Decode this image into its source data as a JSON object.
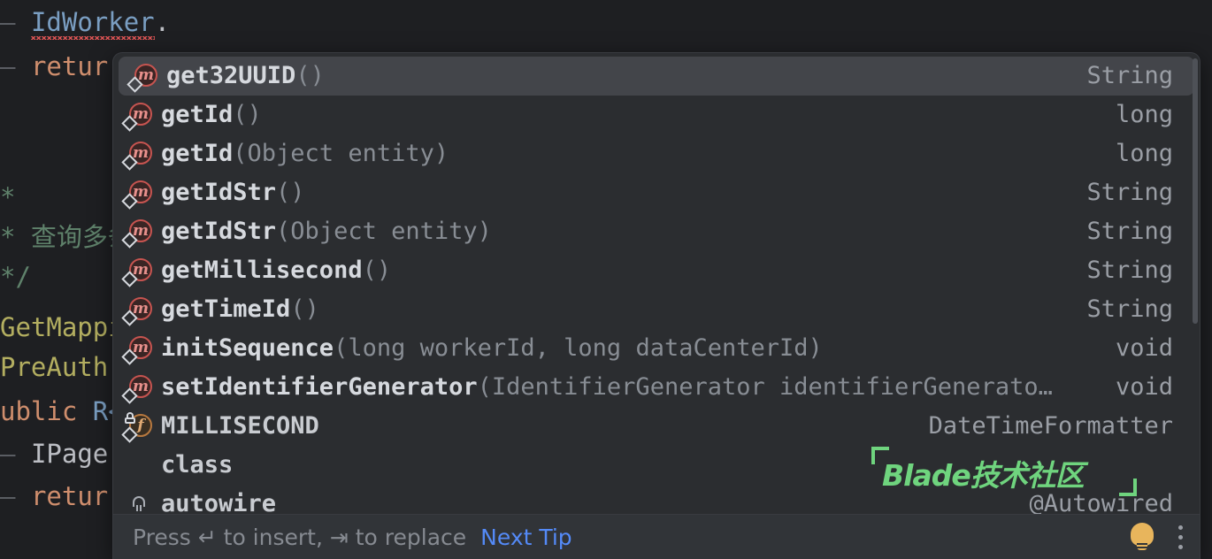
{
  "editor": {
    "lines": [
      {
        "fold": "—",
        "segments": [
          {
            "text": "IdWorker",
            "kind": "class",
            "error": true
          },
          {
            "text": ".",
            "kind": "dot"
          }
        ]
      },
      {
        "fold": "—",
        "segments": [
          {
            "text": "retur",
            "kind": "kw"
          }
        ]
      },
      {
        "fold": "",
        "segments": []
      },
      {
        "fold": "",
        "segments": [
          {
            "text": "*",
            "kind": "comment"
          }
        ]
      },
      {
        "fold": "",
        "segments": [
          {
            "text": "* 查询多条",
            "kind": "comment"
          }
        ]
      },
      {
        "fold": "",
        "segments": [
          {
            "text": "*/",
            "kind": "comment"
          }
        ]
      },
      {
        "fold": "",
        "segments": [
          {
            "text": "GetMappi",
            "kind": "anno"
          }
        ]
      },
      {
        "fold": "",
        "segments": [
          {
            "text": "PreAuth(",
            "kind": "anno"
          }
        ]
      },
      {
        "fold": "",
        "segments": [
          {
            "text": "ublic ",
            "kind": "kw"
          },
          {
            "text": "R<",
            "kind": "blue"
          }
        ]
      },
      {
        "fold": "—",
        "segments": [
          {
            "text": "IPage",
            "kind": "type"
          }
        ]
      },
      {
        "fold": "—",
        "segments": [
          {
            "text": "retur",
            "kind": "kw"
          }
        ]
      }
    ],
    "right_edge_fragment": ")"
  },
  "popup": {
    "items": [
      {
        "icon": "method-static-icon",
        "name": "get32UUID",
        "params": "()",
        "type": "String",
        "selected": true
      },
      {
        "icon": "method-static-icon",
        "name": "getId",
        "params": "()",
        "type": "long",
        "selected": false
      },
      {
        "icon": "method-static-icon",
        "name": "getId",
        "params": "(Object entity)",
        "type": "long",
        "selected": false
      },
      {
        "icon": "method-static-icon",
        "name": "getIdStr",
        "params": "()",
        "type": "String",
        "selected": false
      },
      {
        "icon": "method-static-icon",
        "name": "getIdStr",
        "params": "(Object entity)",
        "type": "String",
        "selected": false
      },
      {
        "icon": "method-static-icon",
        "name": "getMillisecond",
        "params": "()",
        "type": "String",
        "selected": false
      },
      {
        "icon": "method-static-icon",
        "name": "getTimeId",
        "params": "()",
        "type": "String",
        "selected": false
      },
      {
        "icon": "method-static-icon",
        "name": "initSequence",
        "params": "(long workerId, long dataCenterId)",
        "type": "void",
        "selected": false
      },
      {
        "icon": "method-static-icon",
        "name": "setIdentifierGenerator",
        "params": "(IdentifierGenerator identifierGenerato…",
        "type": "void",
        "selected": false
      },
      {
        "icon": "field-static-final-icon",
        "name": "MILLISECOND",
        "params": "",
        "type": "DateTimeFormatter",
        "selected": false
      },
      {
        "icon": "none",
        "name": "class",
        "params": "",
        "type": "",
        "selected": false
      },
      {
        "icon": "parameter-icon",
        "name": "autowire",
        "params": "",
        "type": "@Autowired",
        "selected": false
      }
    ],
    "footer": {
      "hint_prefix": "Press ↵ to insert, ⇥ to replace",
      "next_tip_label": "Next Tip",
      "bulb_icon": "lightbulb-icon",
      "menu_icon": "kebab-menu-icon"
    }
  },
  "watermark": {
    "text": "Blade技术社区",
    "color": "#6fd47e"
  },
  "colors": {
    "editor_bg": "#1e1f22",
    "popup_bg": "#2b2d30",
    "selected_row": "#43454a",
    "footer_bg": "#313438",
    "link": "#548af7",
    "method_icon": "#c75450",
    "field_icon": "#b8793f"
  }
}
